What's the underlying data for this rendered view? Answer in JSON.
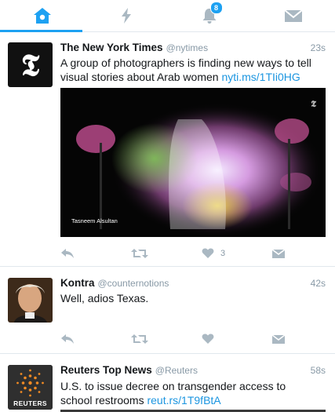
{
  "tabs": [
    {
      "name": "home",
      "icon": "home-icon",
      "active": true
    },
    {
      "name": "moments",
      "icon": "lightning-icon",
      "active": false
    },
    {
      "name": "notifications",
      "icon": "bell-icon",
      "active": false,
      "badge": "8"
    },
    {
      "name": "messages",
      "icon": "envelope-icon",
      "active": false
    }
  ],
  "tweets": [
    {
      "name": "The New York Times",
      "handle": "@nytimes",
      "time": "23s",
      "text": "A group of photographers is finding new ways to tell visual stories about Arab women",
      "link": "nyti.ms/1TIi0HG",
      "media_caption": "Tasneem Alsultan",
      "avatar_letter": "𝕿",
      "likes": "3"
    },
    {
      "name": "Kontra",
      "handle": "@counternotions",
      "time": "42s",
      "text": "Well, adios Texas."
    },
    {
      "name": "Reuters Top News",
      "handle": "@Reuters",
      "time": "58s",
      "text": "U.S. to issue decree on transgender access to school restrooms",
      "link": "reut.rs/1T9fBtA",
      "avatar_label": "REUTERS"
    }
  ],
  "colors": {
    "accent": "#1da1f2",
    "icon_gray": "#aab8c2",
    "link": "#1b95e0"
  }
}
